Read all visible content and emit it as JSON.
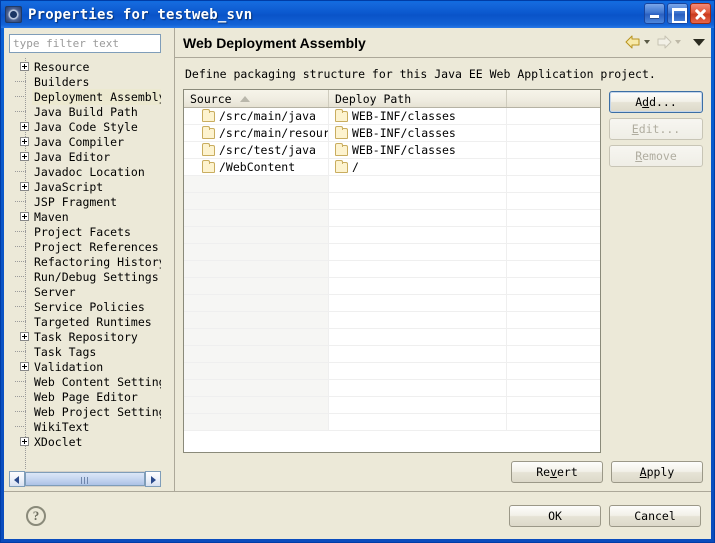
{
  "window": {
    "title": "Properties for testweb_svn",
    "icon": "properties-gear-icon",
    "minimize_label": "Minimize",
    "maximize_label": "Maximize",
    "close_label": "Close"
  },
  "sidebar": {
    "filter_placeholder": "type filter text",
    "filter_value": "",
    "items": [
      {
        "label": "Resource",
        "expandable": true,
        "selected": false
      },
      {
        "label": "Builders",
        "expandable": false,
        "selected": false
      },
      {
        "label": "Deployment Assembly",
        "expandable": false,
        "selected": true
      },
      {
        "label": "Java Build Path",
        "expandable": false,
        "selected": false
      },
      {
        "label": "Java Code Style",
        "expandable": true,
        "selected": false
      },
      {
        "label": "Java Compiler",
        "expandable": true,
        "selected": false
      },
      {
        "label": "Java Editor",
        "expandable": true,
        "selected": false
      },
      {
        "label": "Javadoc Location",
        "expandable": false,
        "selected": false
      },
      {
        "label": "JavaScript",
        "expandable": true,
        "selected": false
      },
      {
        "label": "JSP Fragment",
        "expandable": false,
        "selected": false
      },
      {
        "label": "Maven",
        "expandable": true,
        "selected": false
      },
      {
        "label": "Project Facets",
        "expandable": false,
        "selected": false
      },
      {
        "label": "Project References",
        "expandable": false,
        "selected": false
      },
      {
        "label": "Refactoring History",
        "expandable": false,
        "selected": false
      },
      {
        "label": "Run/Debug Settings",
        "expandable": false,
        "selected": false
      },
      {
        "label": "Server",
        "expandable": false,
        "selected": false
      },
      {
        "label": "Service Policies",
        "expandable": false,
        "selected": false
      },
      {
        "label": "Targeted Runtimes",
        "expandable": false,
        "selected": false
      },
      {
        "label": "Task Repository",
        "expandable": true,
        "selected": false
      },
      {
        "label": "Task Tags",
        "expandable": false,
        "selected": false
      },
      {
        "label": "Validation",
        "expandable": true,
        "selected": false
      },
      {
        "label": "Web Content Settings",
        "expandable": false,
        "selected": false
      },
      {
        "label": "Web Page Editor",
        "expandable": false,
        "selected": false
      },
      {
        "label": "Web Project Settings",
        "expandable": false,
        "selected": false
      },
      {
        "label": "WikiText",
        "expandable": false,
        "selected": false
      },
      {
        "label": "XDoclet",
        "expandable": true,
        "selected": false
      }
    ],
    "scrollbar": {
      "left_arrow": "scroll-left",
      "right_arrow": "scroll-right"
    }
  },
  "main": {
    "title": "Web Deployment Assembly",
    "description": "Define packaging structure for this Java EE Web Application project.",
    "nav": {
      "back_icon": "back-arrow-icon",
      "back_enabled": true,
      "forward_icon": "forward-arrow-icon",
      "forward_enabled": false,
      "menu_icon": "view-menu-chevron-icon"
    },
    "table": {
      "columns": [
        {
          "label": "Source",
          "sort": "ascending"
        },
        {
          "label": "Deploy Path",
          "sort": ""
        },
        {
          "label": "",
          "sort": ""
        }
      ],
      "rows": [
        {
          "source": "/src/main/java",
          "deploy": "WEB-INF/classes"
        },
        {
          "source": "/src/main/resour",
          "deploy": "WEB-INF/classes"
        },
        {
          "source": "/src/test/java",
          "deploy": "WEB-INF/classes"
        },
        {
          "source": "/WebContent",
          "deploy": "/"
        }
      ],
      "empty_row_count": 15
    },
    "side_buttons": [
      {
        "label": "Add...",
        "mnemonic": "d",
        "state": "focused"
      },
      {
        "label": "Edit...",
        "mnemonic": "E",
        "state": "disabled"
      },
      {
        "label": "Remove",
        "mnemonic": "R",
        "state": "disabled"
      }
    ],
    "action_buttons": [
      {
        "label": "Revert",
        "mnemonic": "v"
      },
      {
        "label": "Apply",
        "mnemonic": "A"
      }
    ]
  },
  "footer": {
    "help_icon": "help-question-icon",
    "buttons": [
      {
        "label": "OK"
      },
      {
        "label": "Cancel"
      }
    ]
  },
  "colors": {
    "titlebar_blue": "#0a56c8",
    "dialog_bg": "#ece9d8",
    "selection_bg": "#ece9d0",
    "folder_fill": "#fdf3cf",
    "folder_border": "#c9ad5f",
    "focus_border": "#3b6ea5"
  }
}
